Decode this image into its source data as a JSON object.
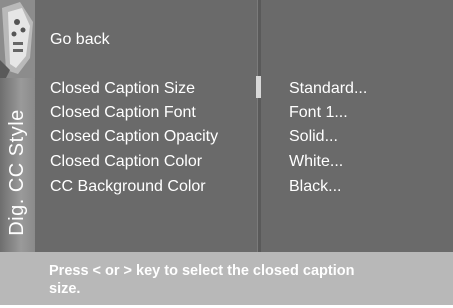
{
  "side_tab": {
    "label": "Dig. CC Style"
  },
  "menu": {
    "go_back": "Go back",
    "items": [
      {
        "label": "Closed Caption Size",
        "value": "Standard..."
      },
      {
        "label": "Closed Caption Font",
        "value": "Font 1..."
      },
      {
        "label": "Closed Caption Opacity",
        "value": "Solid..."
      },
      {
        "label": "Closed Caption Color",
        "value": "White..."
      },
      {
        "label": "CC Background Color",
        "value": "Black..."
      }
    ],
    "selected_index": 0
  },
  "help": {
    "text": "Press < or > key to select the closed caption size."
  },
  "colors": {
    "panel": "#6a6a6a",
    "help_bar": "#b8b8b8",
    "text": "#ffffff"
  }
}
